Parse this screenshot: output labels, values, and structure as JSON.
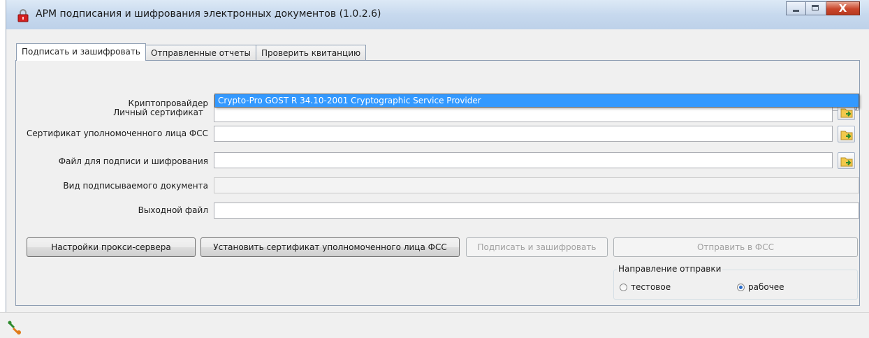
{
  "window": {
    "title": "АРМ подписания и шифрования электронных документов (1.0.2.6)",
    "close_glyph": "X"
  },
  "tabs": [
    {
      "label": "Подписать и зашифровать",
      "active": true
    },
    {
      "label": "Отправленные отчеты",
      "active": false
    },
    {
      "label": "Проверить квитанцию",
      "active": false
    }
  ],
  "form": {
    "crypto_provider": {
      "label": "Криптопровайдер",
      "value": ""
    },
    "crypto_dropdown": {
      "options": [
        "Crypto-Pro GOST R 34.10-2001 Cryptographic Service Provider"
      ],
      "highlighted_index": 0
    },
    "personal_cert": {
      "label": "Личный сертификат",
      "value": ""
    },
    "fss_cert": {
      "label": "Сертификат уполномоченного лица ФСС",
      "value": ""
    },
    "sign_file": {
      "label": "Файл для подписи и шифрования",
      "value": ""
    },
    "doc_type": {
      "label": "Вид подписываемого документа",
      "value": ""
    },
    "output_file": {
      "label": "Выходной файл",
      "value": ""
    }
  },
  "buttons": {
    "proxy_settings": "Настройки прокси-сервера",
    "install_cert": "Установить сертификат уполномоченного лица ФСС",
    "sign_encrypt": "Подписать и зашифровать",
    "send_fss": "Отправить в ФСС"
  },
  "direction": {
    "title": "Направление отправки",
    "options": [
      {
        "label": "тестовое",
        "checked": false
      },
      {
        "label": "рабочее",
        "checked": true
      }
    ]
  },
  "colors": {
    "selection": "#3399ff",
    "titlebar": "#c7d9ee",
    "close_button": "#c9462b"
  }
}
